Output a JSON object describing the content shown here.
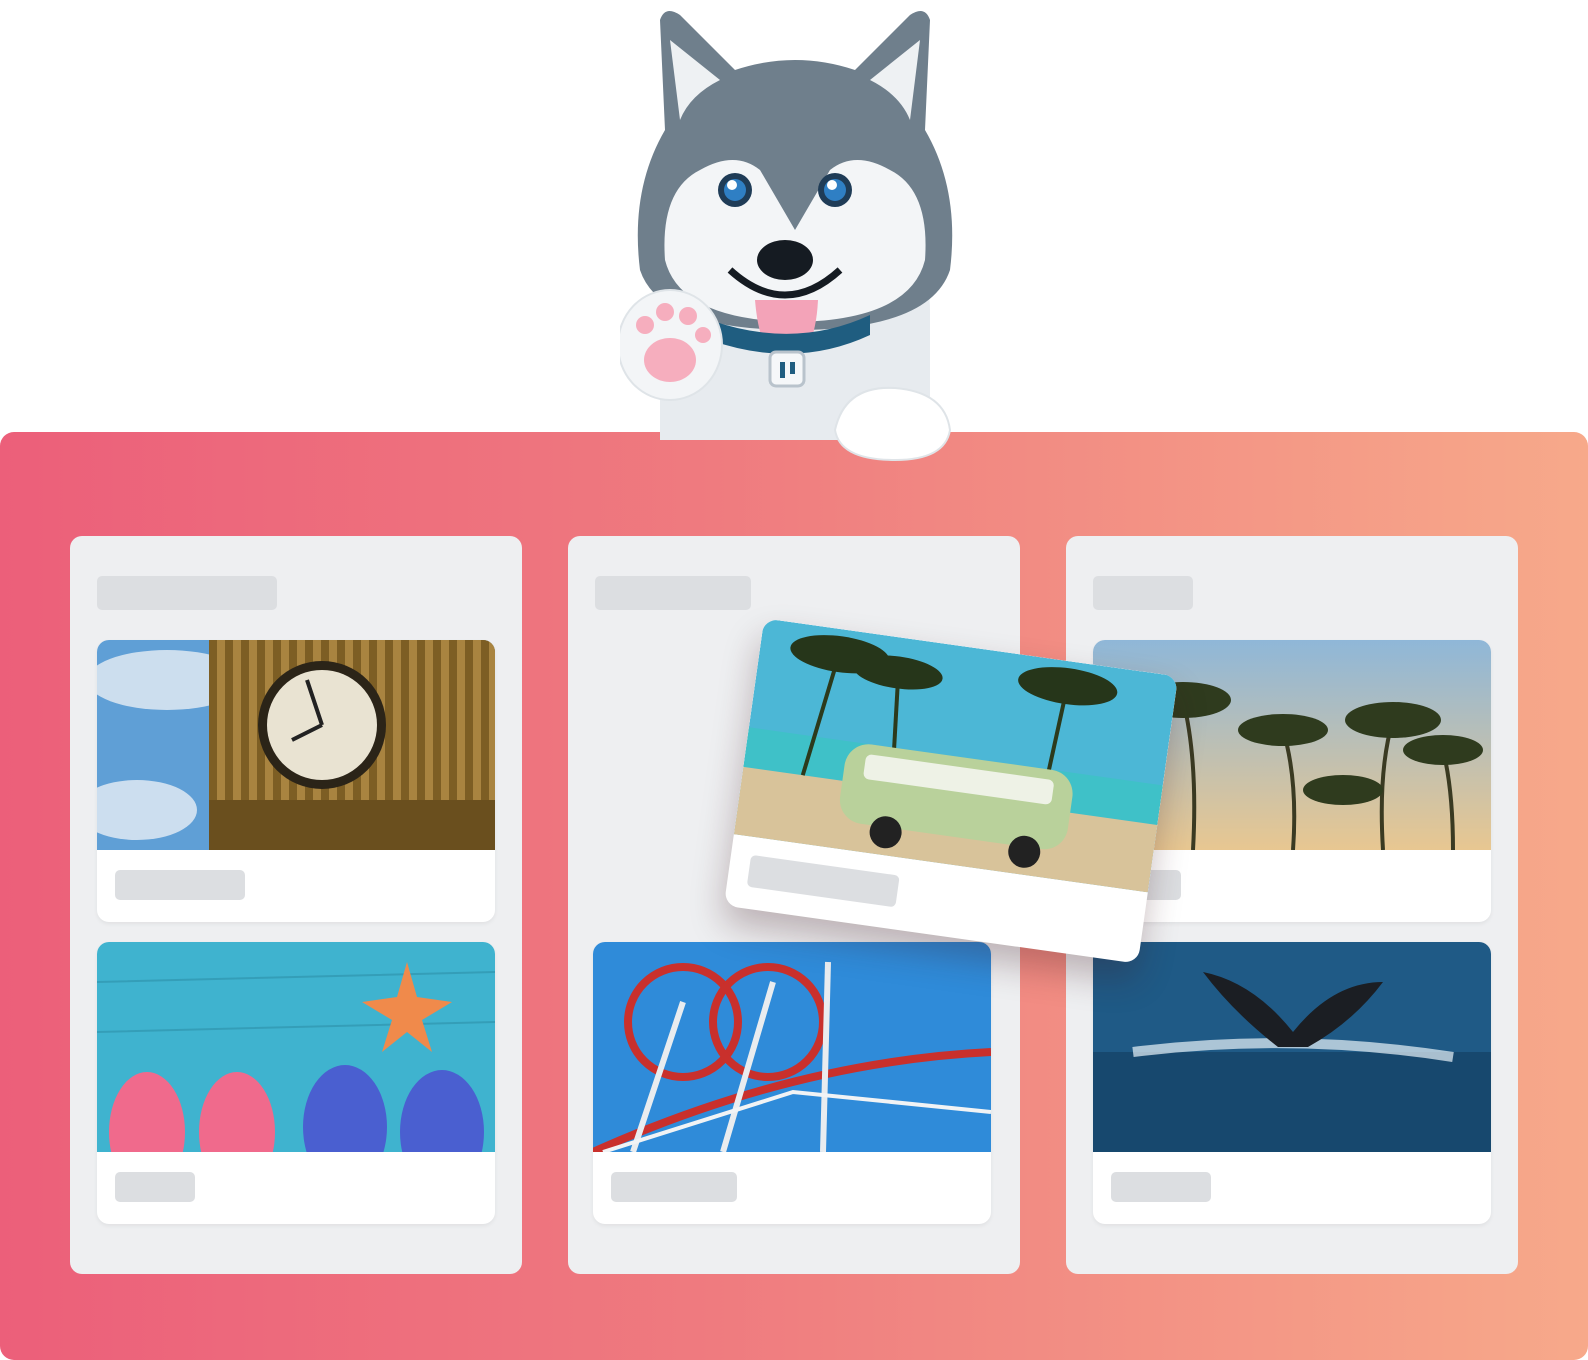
{
  "theme": {
    "gradient_start": "#ec5f7a",
    "gradient_end": "#f7a98a",
    "list_background": "#eeeff1",
    "placeholder_color": "#dcdee1"
  },
  "mascot": {
    "name": "husky-mascot",
    "icon": "husky-waving-icon"
  },
  "lists": [
    {
      "name": "list-1",
      "cards": [
        {
          "image": "big-ben-clock-tower"
        },
        {
          "image": "flip-flops-and-starfish"
        }
      ]
    },
    {
      "name": "list-2",
      "cards": [
        {
          "image": "roller-coaster"
        }
      ]
    },
    {
      "name": "list-3",
      "cards": [
        {
          "image": "palm-trees-sunset"
        },
        {
          "image": "whale-tail-ocean"
        }
      ]
    }
  ],
  "dragging_card": {
    "image": "camper-van-beach"
  }
}
